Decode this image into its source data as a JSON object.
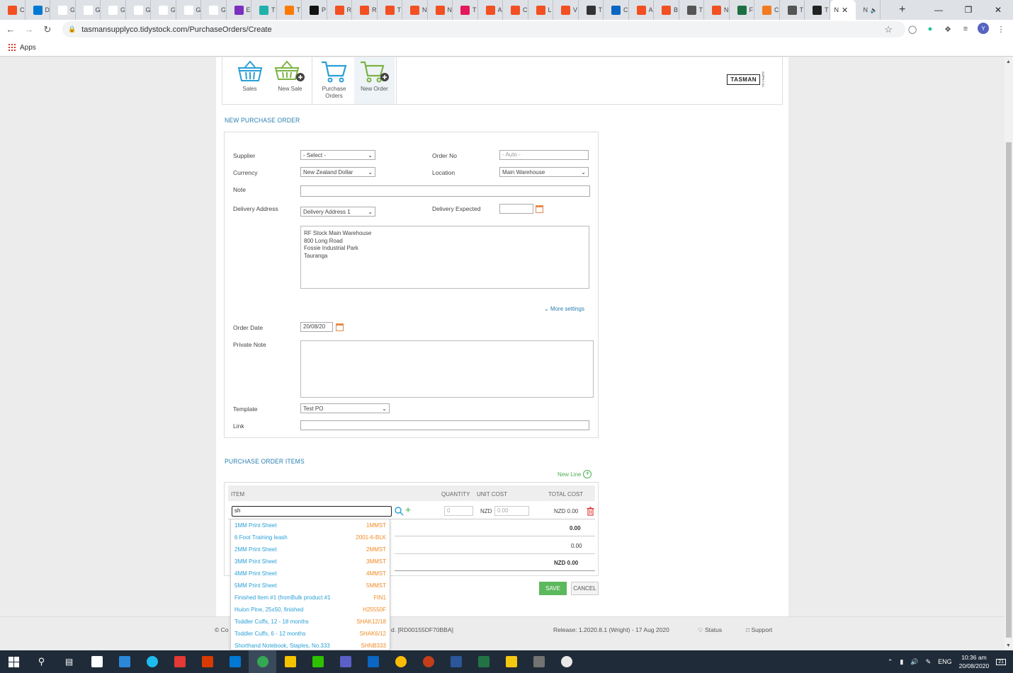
{
  "browser": {
    "tabs": [
      {
        "title": "C",
        "color": "#f25022"
      },
      {
        "title": "D",
        "color": "#0078d4"
      },
      {
        "title": "G",
        "color": "#ffffff"
      },
      {
        "title": "G",
        "color": "#ffffff"
      },
      {
        "title": "G",
        "color": "#ffffff"
      },
      {
        "title": "G",
        "color": "#ffffff"
      },
      {
        "title": "G",
        "color": "#ffffff"
      },
      {
        "title": "G",
        "color": "#ffffff"
      },
      {
        "title": "G",
        "color": "#ffffff"
      },
      {
        "title": "E",
        "color": "#7b2fbe"
      },
      {
        "title": "T",
        "color": "#20b2aa"
      },
      {
        "title": "T",
        "color": "#ff7a00"
      },
      {
        "title": "P",
        "color": "#111111"
      },
      {
        "title": "R",
        "color": "#f25022"
      },
      {
        "title": "R",
        "color": "#f25022"
      },
      {
        "title": "T",
        "color": "#f25022"
      },
      {
        "title": "N",
        "color": "#f25022"
      },
      {
        "title": "N",
        "color": "#f25022"
      },
      {
        "title": "T",
        "color": "#e4185a"
      },
      {
        "title": "A",
        "color": "#f25022"
      },
      {
        "title": "C",
        "color": "#f25022"
      },
      {
        "title": "L",
        "color": "#f25022"
      },
      {
        "title": "V",
        "color": "#f25022"
      },
      {
        "title": "T",
        "color": "#333333"
      },
      {
        "title": "C",
        "color": "#0a66c2"
      },
      {
        "title": "A",
        "color": "#f25022"
      },
      {
        "title": "B",
        "color": "#f25022"
      },
      {
        "title": "T",
        "color": "#555555"
      },
      {
        "title": "N",
        "color": "#f25022"
      },
      {
        "title": "F",
        "color": "#1d6f42"
      },
      {
        "title": "C",
        "color": "#f27b21"
      },
      {
        "title": "T",
        "color": "#555555"
      },
      {
        "title": "T",
        "color": "#222222"
      }
    ],
    "active_tab": "N",
    "last_tab": "N",
    "url": "tasmansupplyco.tidystock.com/PurchaseOrders/Create",
    "bookmarks_apps": "Apps"
  },
  "nav": {
    "sales": "Sales",
    "new_sale": "New Sale",
    "purchase_orders_line1": "Purchase",
    "purchase_orders_line2": "Orders",
    "new_order": "New Order"
  },
  "logo": {
    "main": "TASMAN",
    "sub": "SUPPLY Co."
  },
  "colors": {
    "accent_blue": "#2a7fb1",
    "basket_blue": "#2a9fd6",
    "basket_green": "#7cb342",
    "save_green": "#5cb85c",
    "code_orange": "#f08a24"
  },
  "form": {
    "title": "NEW PURCHASE ORDER",
    "supplier_label": "Supplier",
    "supplier_value": "- Select -",
    "order_no_label": "Order No",
    "order_no_placeholder": "- Auto -",
    "currency_label": "Currency",
    "currency_value": "New Zealand Dollar",
    "location_label": "Location",
    "location_value": "Main Warehouse",
    "note_label": "Note",
    "delivery_address_label": "Delivery Address",
    "delivery_address_value": "Delivery Address 1",
    "delivery_expected_label": "Delivery Expected",
    "address_lines": [
      "RF Stock Main Warehouse",
      "800 Long Road",
      "Fossie Industrial Park",
      "Tauranga"
    ],
    "more_settings": "More settings",
    "order_date_label": "Order Date",
    "order_date_value": "20/08/20",
    "private_note_label": "Private Note",
    "template_label": "Template",
    "template_value": "Test PO",
    "link_label": "Link"
  },
  "items": {
    "title": "PURCHASE ORDER ITEMS",
    "new_line": "New Line",
    "col_item": "ITEM",
    "col_quantity": "QUANTITY",
    "col_unit_cost": "UNIT COST",
    "col_total_cost": "TOTAL COST",
    "search_value": "sh",
    "qty_placeholder": "0",
    "currency_prefix": "NZD",
    "unit_cost_placeholder": "0.00",
    "line_total": "NZD 0.00",
    "subtotal": "0.00",
    "tax": "0.00",
    "grand_total": "NZD 0.00"
  },
  "dropdown": [
    {
      "name": "1MM Print Sheet",
      "code": "1MMST"
    },
    {
      "name": "6 Foot Training leash",
      "code": "2001-6-BLK"
    },
    {
      "name": "2MM Print Sheet",
      "code": "2MMST"
    },
    {
      "name": "3MM Print Sheet",
      "code": "3MMST"
    },
    {
      "name": "4MM Print Sheet",
      "code": "4MMST"
    },
    {
      "name": "5MM Print Sheet",
      "code": "5MMST"
    },
    {
      "name": "Finished Item #1 (fromBulk product #1",
      "code": "FIN1"
    },
    {
      "name": "Huion Pine, 25x50, finished",
      "code": "H25550F"
    },
    {
      "name": "Toddler Cuffs, 12 - 18 months",
      "code": "SHAK12/18"
    },
    {
      "name": "Toddler Cuffs, 6 - 12 months",
      "code": "SHAK6/12"
    },
    {
      "name": "Shorthand Notebook, Staples, No.333",
      "code": "SHNB333"
    }
  ],
  "buttons": {
    "save": "SAVE",
    "cancel": "CANCEL"
  },
  "footer": {
    "copyright": "© Co",
    "build": "d. [RD00155DF70BBA]",
    "release": "Release: 1.2020.8.1 (Wright) - 17 Aug 2020",
    "status": "Status",
    "support": "Support"
  },
  "taskbar": {
    "lang": "ENG",
    "time": "10:36 am",
    "date": "20/08/2020",
    "notifications": "21"
  }
}
